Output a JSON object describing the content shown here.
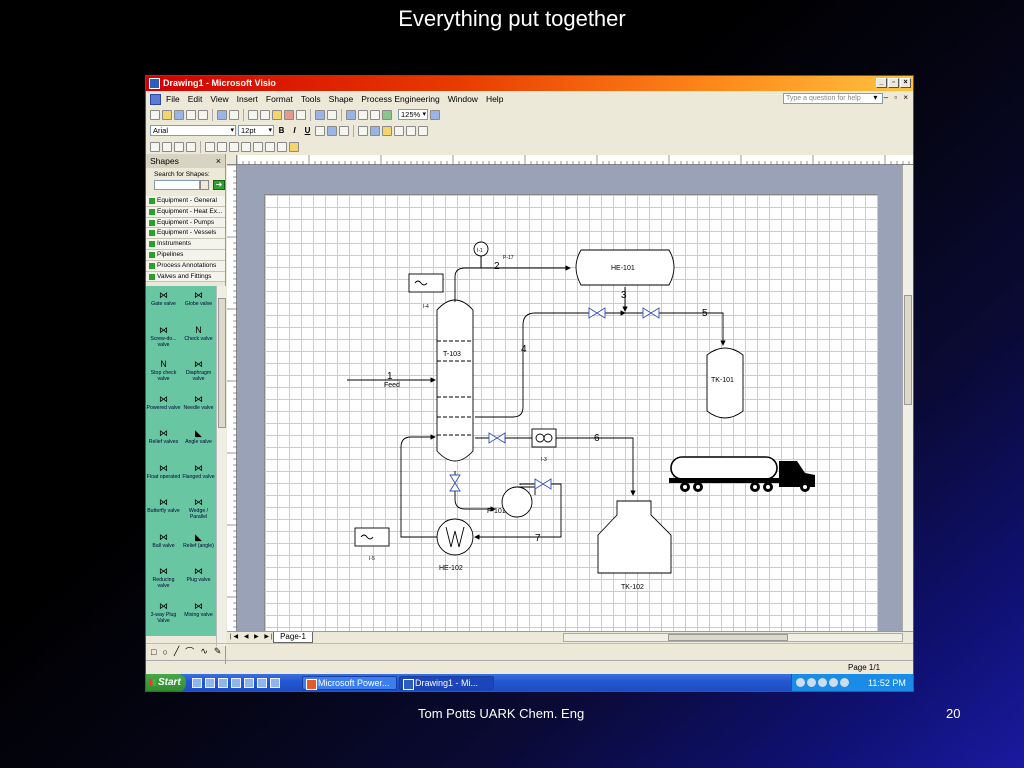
{
  "slide": {
    "title": "Everything put together",
    "footer_text": "Tom Potts  UARK Chem. Eng",
    "page_number": "20"
  },
  "window": {
    "title": "Drawing1 - Microsoft Visio",
    "menu": [
      "File",
      "Edit",
      "View",
      "Insert",
      "Format",
      "Tools",
      "Shape",
      "Process Engineering",
      "Window",
      "Help"
    ],
    "ask_placeholder": "Type a question for help",
    "zoom": "125%",
    "font": "Arial",
    "font_size": "12pt"
  },
  "shapes_panel": {
    "title": "Shapes",
    "search_label": "Search for Shapes:",
    "stencils": [
      "Equipment - General",
      "Equipment - Heat Ex...",
      "Equipment - Pumps",
      "Equipment - Vessels",
      "Instruments",
      "Pipelines",
      "Process Annotations",
      "Valves and Fittings"
    ],
    "shapes": [
      {
        "label": "Gate valve",
        "icon": "gate-valve-icon",
        "sym": "⋈"
      },
      {
        "label": "Globe valve",
        "icon": "globe-valve-icon",
        "sym": "⋈"
      },
      {
        "label": "Screw-do... valve",
        "icon": "screw-down-valve-icon",
        "sym": "⋈"
      },
      {
        "label": "Check valve",
        "icon": "check-valve-icon",
        "sym": "N"
      },
      {
        "label": "Stop check valve",
        "icon": "stop-check-valve-icon",
        "sym": "N"
      },
      {
        "label": "Diaphragm valve",
        "icon": "diaphragm-valve-icon",
        "sym": "⋈"
      },
      {
        "label": "Powered valve",
        "icon": "powered-valve-icon",
        "sym": "⋈"
      },
      {
        "label": "Needle valve",
        "icon": "needle-valve-icon",
        "sym": "⋈"
      },
      {
        "label": "Relief valves",
        "icon": "relief-valve-icon",
        "sym": "⋈"
      },
      {
        "label": "Angle valve",
        "icon": "angle-valve-icon",
        "sym": "◣"
      },
      {
        "label": "Float operated",
        "icon": "float-operated-valve-icon",
        "sym": "⋈"
      },
      {
        "label": "Flanged valve",
        "icon": "flanged-valve-icon",
        "sym": "⋈"
      },
      {
        "label": "Butterfly valve",
        "icon": "butterfly-valve-icon",
        "sym": "⋈"
      },
      {
        "label": "Wedge / Parallel",
        "icon": "wedge-parallel-valve-icon",
        "sym": "⋈"
      },
      {
        "label": "Ball valve",
        "icon": "ball-valve-icon",
        "sym": "⋈"
      },
      {
        "label": "Relief (angle)",
        "icon": "relief-angle-valve-icon",
        "sym": "◣"
      },
      {
        "label": "Reducing valve",
        "icon": "reducing-valve-icon",
        "sym": "⋈"
      },
      {
        "label": "Plug valve",
        "icon": "plug-valve-icon",
        "sym": "⋈"
      },
      {
        "label": "3-way Plug Valve",
        "icon": "three-way-plug-valve-icon",
        "sym": "⋈"
      },
      {
        "label": "Mixing valve",
        "icon": "mixing-valve-icon",
        "sym": "⋈"
      }
    ]
  },
  "diagram": {
    "streams": [
      "1",
      "2",
      "3",
      "4",
      "5",
      "6",
      "7"
    ],
    "feed_label": "Feed",
    "labels": {
      "column": "T-103",
      "exchanger_top": "HE-101",
      "tank_right": "TK-101",
      "pump": "P-101",
      "exchanger_bottom": "HE-102",
      "tank_bottom": "TK-102",
      "instrument_top": "I-4",
      "instrument_bottom": "I-5",
      "instrument_mid": "I-3",
      "pump_tag": "P-17",
      "gauge_tag": "I-1"
    }
  },
  "bottom": {
    "page_tab": "Page-1",
    "status_page": "Page 1/1"
  },
  "taskbar": {
    "start": "Start",
    "tasks": [
      "Microsoft Power...",
      "Drawing1 - Mi..."
    ],
    "clock": "11:52 PM"
  }
}
